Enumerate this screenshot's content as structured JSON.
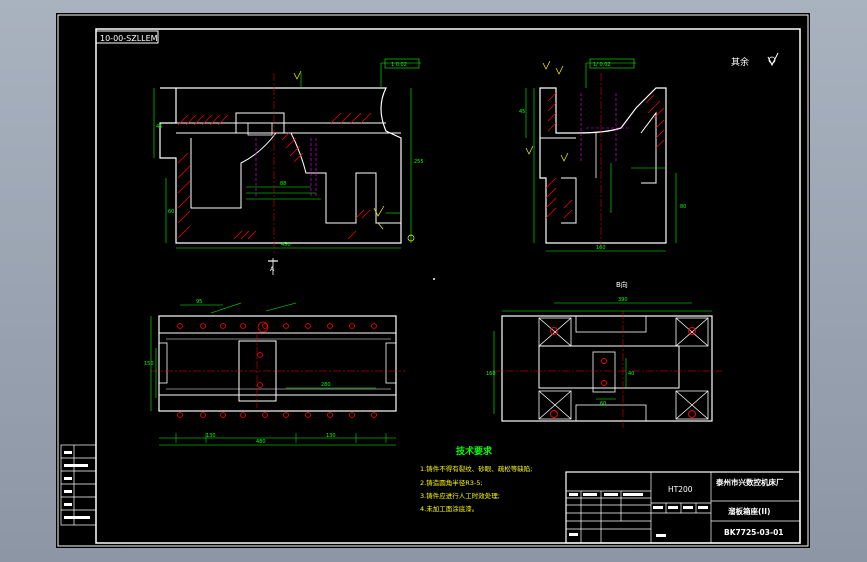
{
  "drawing": {
    "code_rotated": "10-00-SZLLEM",
    "roughness_note": "其余",
    "section_label_a": "A",
    "view_label": "B向",
    "material": "HT200",
    "company": "泰州市兴数控机床厂",
    "part_name": "溜板箱座(II)",
    "drawing_no": "BK7725-03-01"
  },
  "tech_requirements": {
    "title": "技术要求",
    "items": [
      "1.铸件不得有裂纹、砂眼、疏松等缺陷;",
      "2.铸造圆角半径R3-5;",
      "3.铸件应进行人工时效处理;",
      "4.未加工面涂底漆。"
    ]
  },
  "colors": {
    "background": "#000000",
    "frame": "#ffffff",
    "outline": "#ffffff",
    "dimension": "#00ff00",
    "hatch": "#ff0000",
    "centerline": "#ff0000",
    "annotation": "#ffff00",
    "hidden": "#ff00ff"
  }
}
